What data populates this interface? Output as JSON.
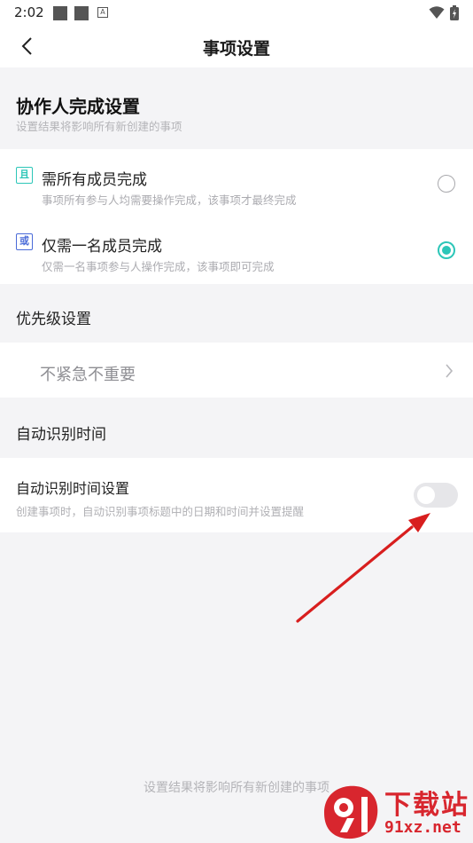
{
  "status_bar": {
    "time": "2:02",
    "icons": [
      "square-icon",
      "square-icon",
      "a-icon",
      "wifi-icon",
      "battery-icon"
    ]
  },
  "nav": {
    "title": "事项设置",
    "back_icon": "chevron-left-icon"
  },
  "collaborator": {
    "title": "协作人完成设置",
    "subtitle": "设置结果将影响所有新创建的事项",
    "options": [
      {
        "badge": "且",
        "badge_color": "#2cc6b8",
        "title": "需所有成员完成",
        "description": "事项所有参与人均需要操作完成，该事项才最终完成",
        "selected": false
      },
      {
        "badge": "或",
        "badge_color": "#4a6bd8",
        "title": "仅需一名成员完成",
        "description": "仅需一名事项参与人操作完成，该事项即可完成",
        "selected": true
      }
    ]
  },
  "priority": {
    "label": "优先级设置",
    "value": "不紧急不重要"
  },
  "auto_time": {
    "label": "自动识别时间",
    "setting_title": "自动识别时间设置",
    "setting_desc": "创建事项时，自动识别事项标题中的日期和时间并设置提醒",
    "enabled": false
  },
  "footer_note": "设置结果将影响所有新创建的事项",
  "watermark": {
    "text1": "下载站",
    "text2": "91xz.net"
  },
  "colors": {
    "accent": "#2cc6b8",
    "annotation_arrow": "#d81e1e",
    "watermark": "#d8262e"
  }
}
